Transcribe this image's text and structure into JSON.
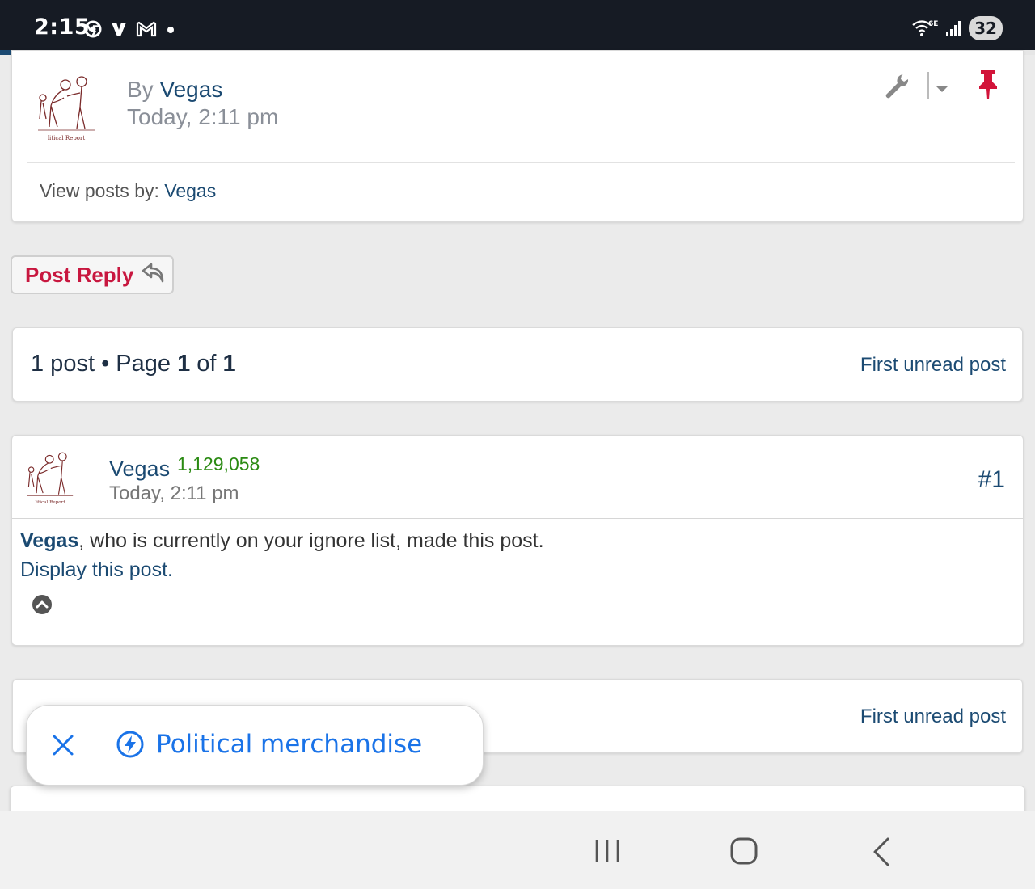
{
  "status_bar": {
    "time": "2:15",
    "left_icons": [
      "chrome-icon",
      "v-app-icon",
      "gmail-icon",
      "notification-dot-icon"
    ],
    "wifi_label": "6E",
    "battery": "32"
  },
  "page_progress": 0.41,
  "topic_header": {
    "by_prefix": "By",
    "author": "Vegas",
    "date": "Today, 2:11 pm",
    "view_posts_prefix": "View posts by:",
    "view_posts_author": "Vegas",
    "avatar_caption": "litical Report"
  },
  "post_reply_button": {
    "label": "Post Reply"
  },
  "pagination": {
    "count_text": "1 post",
    "separator": "•",
    "page_word": "Page",
    "current_page": "1",
    "of_word": "of",
    "total_pages": "1",
    "first_unread": "First unread post"
  },
  "post": {
    "author": "Vegas",
    "post_count": "1,129,058",
    "date": "Today, 2:11 pm",
    "number": "#1",
    "ignore_name": "Vegas",
    "ignore_message": ", who is currently on your ignore list, made this post.",
    "display_link": "Display this post.",
    "avatar_caption": "litical Report"
  },
  "pagination_bottom": {
    "first_unread": "First unread post"
  },
  "chip": {
    "label": "Political merchandise"
  },
  "colors": {
    "link": "#1b4a72",
    "reply": "#c8173f",
    "pin": "#d2143a",
    "post_count": "#2a8a12",
    "chip_text": "#1a73e8"
  }
}
